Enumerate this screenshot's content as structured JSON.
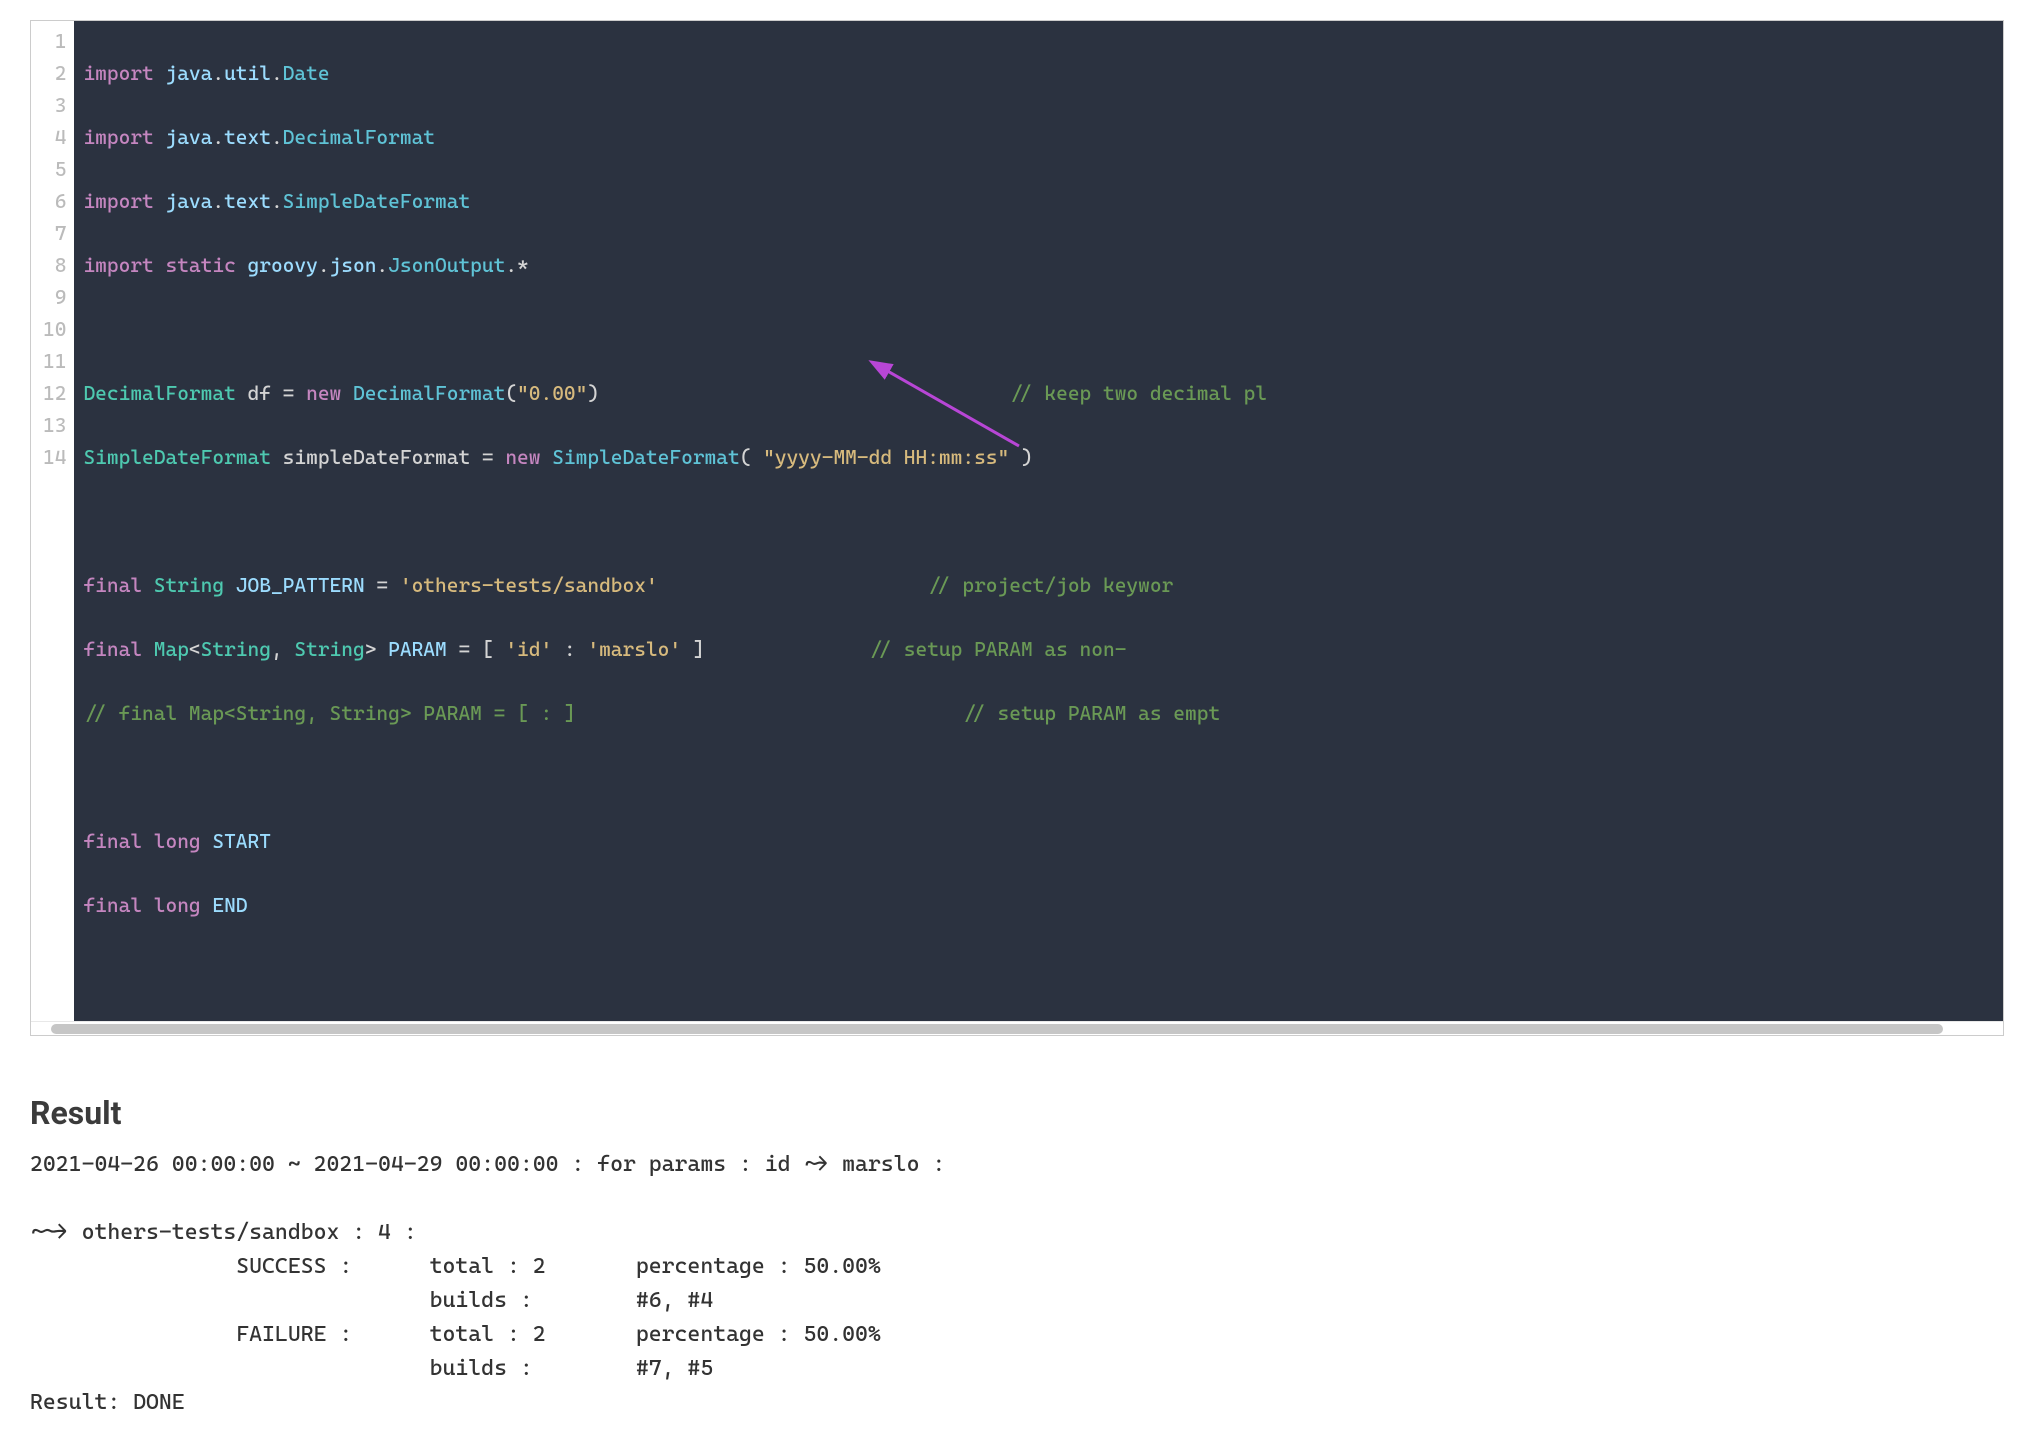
{
  "editor": {
    "line_numbers": [
      "1",
      "2",
      "3",
      "4",
      "5",
      "6",
      "7",
      "8",
      "9",
      "10",
      "11",
      "12",
      "13",
      "14"
    ],
    "lines": {
      "l1": {
        "kw": "import",
        "ns": "java",
        "dot1": ".",
        "sub1": "util",
        "dot2": ".",
        "cls": "Date"
      },
      "l2": {
        "kw": "import",
        "ns": "java",
        "dot1": ".",
        "sub1": "text",
        "dot2": ".",
        "cls": "DecimalFormat"
      },
      "l3": {
        "kw": "import",
        "ns": "java",
        "dot1": ".",
        "sub1": "text",
        "dot2": ".",
        "cls": "SimpleDateFormat"
      },
      "l4": {
        "kw": "import",
        "kw2": "static",
        "ns": "groovy",
        "dot1": ".",
        "sub1": "json",
        "dot2": ".",
        "cls": "JsonOutput",
        "dot3": ".",
        "star": "*"
      },
      "l6": {
        "type": "DecimalFormat",
        "var": "df",
        "eq": " = ",
        "new": "new",
        "ctor": "DecimalFormat",
        "lp": "(",
        "str": "\"0.00\"",
        "rp": ")",
        "cmt": "// keep two decimal pl"
      },
      "l7": {
        "type": "SimpleDateFormat",
        "var": "simpleDateFormat",
        "eq": " = ",
        "new": "new",
        "ctor": "SimpleDateFormat",
        "lp": "( ",
        "str": "\"yyyy-MM-dd HH:mm:ss\"",
        "rp": " )"
      },
      "l9": {
        "final": "final",
        "type": "String",
        "var": "JOB_PATTERN",
        "eq": " = ",
        "str": "'others-tests/sandbox'",
        "cmt": "// project/job keywor"
      },
      "l10": {
        "final": "final",
        "type": "Map",
        "lt": "<",
        "t1": "String",
        "cm": ", ",
        "t2": "String",
        "gt": ">",
        "var": "PARAM",
        "eq": " = ",
        "lb": "[ ",
        "k": "'id'",
        "col": " : ",
        "v": "'marslo'",
        "rb": " ]",
        "cmt": "// setup PARAM as non-"
      },
      "l11": {
        "cmt1": "// final Map<String, String> PARAM = [ : ]",
        "cmt2": "// setup PARAM as empt"
      },
      "l13": {
        "final": "final",
        "type": "long",
        "var": "START"
      },
      "l14": {
        "final": "final",
        "type": "long",
        "var": "END"
      }
    }
  },
  "result": {
    "heading": "Result",
    "r1": "2021-04-26 00:00:00 ~ 2021-04-29 00:00:00 : for params : id ~> marslo :",
    "r2": "",
    "r3": "~~> others-tests/sandbox : 4 :",
    "r4": "                SUCCESS :      total : 2       percentage : 50.00%",
    "r5": "                               builds :        #6, #4",
    "r6": "                FAILURE :      total : 2       percentage : 50.00%",
    "r7": "                               builds :        #7, #5",
    "r8": "Result: DONE"
  }
}
